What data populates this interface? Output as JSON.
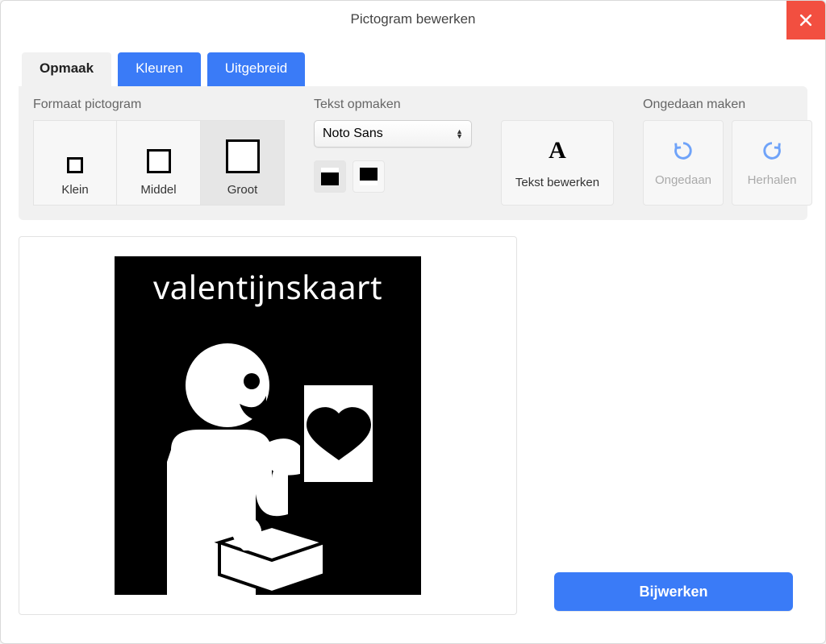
{
  "window": {
    "title": "Pictogram bewerken"
  },
  "tabs": {
    "format": "Opmaak",
    "colors": "Kleuren",
    "advanced": "Uitgebreid",
    "active": "format"
  },
  "toolbar": {
    "format_group": {
      "title": "Formaat pictogram",
      "options": {
        "small": "Klein",
        "medium": "Middel",
        "large": "Groot"
      },
      "selected": "large"
    },
    "text_group": {
      "title": "Tekst opmaken",
      "font_selected": "Noto Sans",
      "edit_text_label": "Tekst bewerken"
    },
    "undo_group": {
      "title": "Ongedaan maken",
      "undo_label": "Ongedaan",
      "redo_label": "Herhalen"
    }
  },
  "pictogram": {
    "label": "valentijnskaart"
  },
  "buttons": {
    "update": "Bijwerken"
  }
}
